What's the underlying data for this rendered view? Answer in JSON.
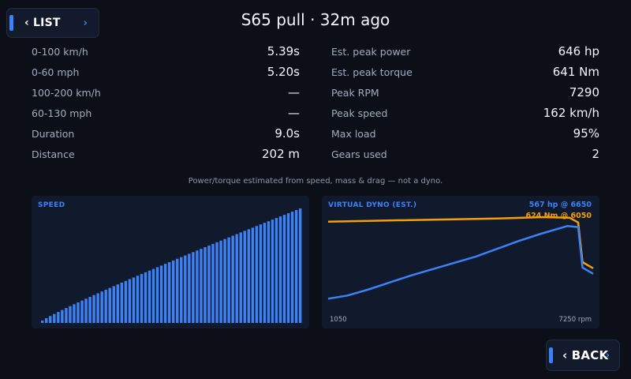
{
  "header": {
    "list_button": "‹ LIST",
    "list_chevron": "›",
    "title": "S65 pull · 32m ago"
  },
  "stats_left": [
    {
      "label": "0-100 km/h",
      "value": "5.39s"
    },
    {
      "label": "0-60 mph",
      "value": "5.20s"
    },
    {
      "label": "100-200 km/h",
      "value": "—"
    },
    {
      "label": "60-130 mph",
      "value": "—"
    },
    {
      "label": "Duration",
      "value": "9.0s"
    },
    {
      "label": "Distance",
      "value": "202 m"
    }
  ],
  "stats_right": [
    {
      "label": "Est. peak power",
      "value": "646 hp"
    },
    {
      "label": "Est. peak torque",
      "value": "641 Nm"
    },
    {
      "label": "Peak RPM",
      "value": "7290"
    },
    {
      "label": "Peak speed",
      "value": "162 km/h"
    },
    {
      "label": "Max load",
      "value": "95%"
    },
    {
      "label": "Gears used",
      "value": "2"
    }
  ],
  "note": "Power/torque estimated from speed, mass & drag — not a dyno.",
  "speed_chart": {
    "title": "SPEED",
    "bar_count": 66,
    "peak_speed_kmh": 162
  },
  "dyno_chart": {
    "title": "VIRTUAL DYNO (EST.)",
    "peak_hp_label": "567 hp @ 6650",
    "peak_nm_label": "624 Nm @ 6050",
    "x_min_label": "1050",
    "x_max_label": "7250 rpm",
    "x_range": [
      1050,
      7250
    ],
    "y_max": 700,
    "power_color": "#3b82f6",
    "torque_color": "#f59e0b",
    "power_hp": [
      [
        1050,
        100
      ],
      [
        1500,
        120
      ],
      [
        2000,
        160
      ],
      [
        2500,
        205
      ],
      [
        3000,
        250
      ],
      [
        3500,
        290
      ],
      [
        4000,
        330
      ],
      [
        4500,
        370
      ],
      [
        5000,
        420
      ],
      [
        5500,
        470
      ],
      [
        6000,
        515
      ],
      [
        6650,
        567
      ],
      [
        6900,
        560
      ],
      [
        7000,
        300
      ],
      [
        7250,
        260
      ]
    ],
    "torque_nm": [
      [
        1050,
        595
      ],
      [
        2000,
        600
      ],
      [
        3000,
        605
      ],
      [
        4000,
        610
      ],
      [
        5000,
        615
      ],
      [
        6050,
        624
      ],
      [
        6700,
        620
      ],
      [
        6900,
        590
      ],
      [
        7000,
        335
      ],
      [
        7250,
        295
      ]
    ]
  },
  "footer": {
    "back_button": "‹ BACK",
    "back_chevron": "›"
  }
}
